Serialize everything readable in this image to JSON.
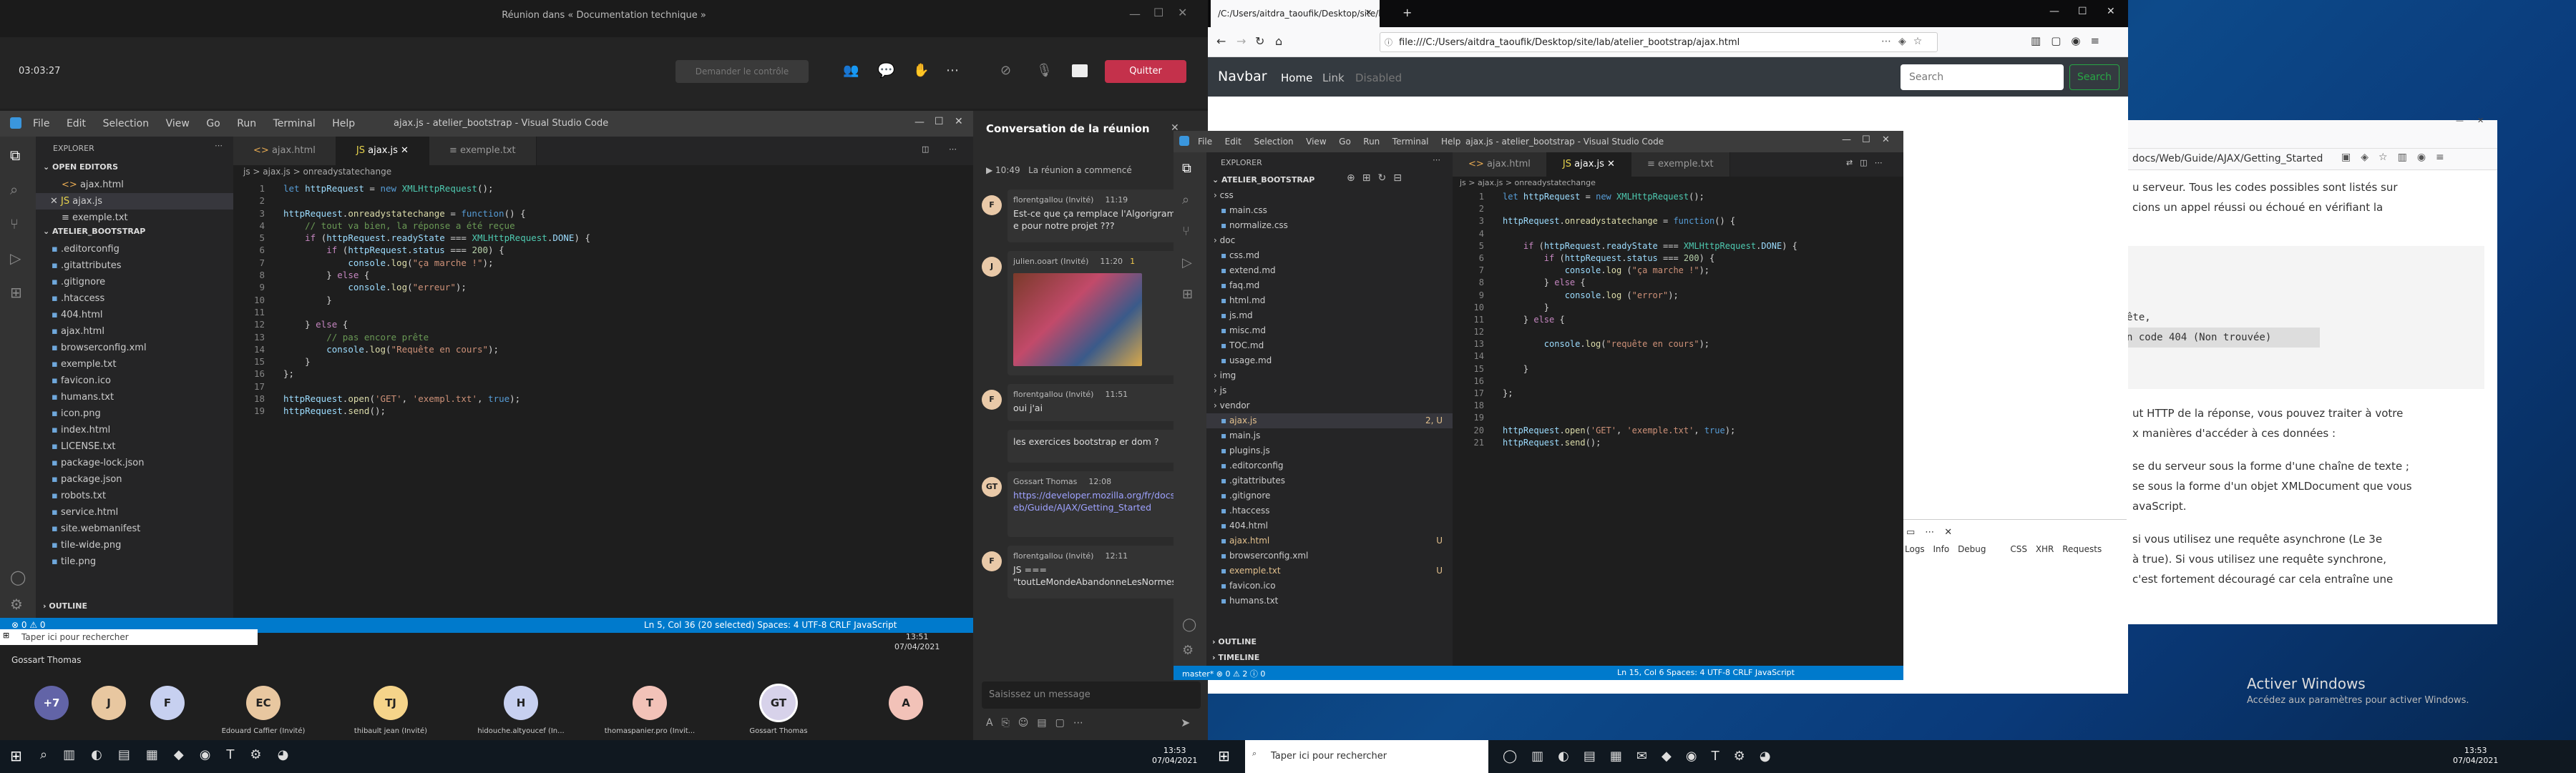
{
  "teams": {
    "window_title": "Réunion dans « Documentation technique »",
    "timer": "03:03:27",
    "request_control": "Demander le contrôle",
    "leave": "Quitter",
    "chat_title": "Conversation de la réunion",
    "chat_started_time": "10:49",
    "chat_started_text": "La réunion a commencé",
    "messages": [
      {
        "author": "florentgallou (Invité)",
        "time": "11:19",
        "text": "Est-ce que ça remplace l'Algorigramme pour notre projet ???",
        "avatar": "F"
      },
      {
        "author": "julien.ooart (Invité)",
        "time": "11:20",
        "text": "",
        "avatar": "J",
        "reaction": "1"
      },
      {
        "author": "florentgallou (Invité)",
        "time": "11:51",
        "text": "oui j'ai",
        "avatar": "F"
      },
      {
        "author": "",
        "time": "",
        "text": "les exercices bootstrap er dom ?",
        "avatar": ""
      },
      {
        "author": "Gossart Thomas",
        "time": "12:08",
        "text": "https://developer.mozilla.org/fr/docs/Web/Guide/AJAX/Getting_Started",
        "avatar": "GT"
      },
      {
        "author": "florentgallou (Invité)",
        "time": "12:11",
        "text": "JS ===\n\"toutLeMondeAbandonneLesNormes\"",
        "avatar": "F"
      }
    ],
    "compose_placeholder": "Saisissez un message",
    "participants": [
      {
        "label": "+7",
        "color": "#6264a7",
        "name": ""
      },
      {
        "label": "J",
        "color": "#e8c7a0",
        "name": ""
      },
      {
        "label": "F",
        "color": "#c7d0f0",
        "name": ""
      },
      {
        "label": "EC",
        "color": "#e8c7a0",
        "name": "Edouard Caffier (Invité)"
      },
      {
        "label": "TJ",
        "color": "#f5d48a",
        "name": "thibault jean (Invité)"
      },
      {
        "label": "H",
        "color": "#c7d0f0",
        "name": "hidouche.altyoucef (In..."
      },
      {
        "label": "T",
        "color": "#f2c2b8",
        "name": "thomaspanier.pro (Invit..."
      },
      {
        "label": "GT",
        "color": "#d7d2ea",
        "name": "Gossart Thomas"
      },
      {
        "label": "A",
        "color": "#f2c2b8",
        "name": ""
      }
    ],
    "speaker_label": "Gossart Thomas"
  },
  "vscode1": {
    "menus": [
      "File",
      "Edit",
      "Selection",
      "View",
      "Go",
      "Run",
      "Terminal",
      "Help"
    ],
    "title": "ajax.js - atelier_bootstrap - Visual Studio Code",
    "explorer_title": "EXPLORER",
    "open_editors": "OPEN EDITORS",
    "open_files": [
      "ajax.html",
      "ajax.js",
      "exemple.txt"
    ],
    "folder": "ATELIER_BOOTSTRAP",
    "files": [
      ".editorconfig",
      ".gitattributes",
      ".gitignore",
      ".htaccess",
      "404.html",
      "ajax.html",
      "browserconfig.xml",
      "exemple.txt",
      "favicon.ico",
      "humans.txt",
      "icon.png",
      "index.html",
      "LICENSE.txt",
      "package-lock.json",
      "package.json",
      "robots.txt",
      "service.html",
      "site.webmanifest",
      "tile-wide.png",
      "tile.png"
    ],
    "outline": "OUTLINE",
    "tabs": [
      "ajax.html",
      "ajax.js",
      "exemple.txt"
    ],
    "breadcrumb": "js > ajax.js > onreadystatechange",
    "code": [
      "let httpRequest = new XMLHttpRequest();",
      "",
      "httpRequest.onreadystatechange = function() {",
      "    // tout va bien, la réponse a été reçue",
      "    if (httpRequest.readyState === XMLHttpRequest.DONE) {",
      "        if (httpRequest.status === 200) {",
      "            console.log(\"ça marche !\");",
      "        } else {",
      "            console.log(\"erreur\");",
      "        }",
      "",
      "    } else {",
      "        // pas encore prête",
      "        console.log(\"Requête en cours\");",
      "    }",
      "};",
      "",
      "httpRequest.open('GET', 'exempl.txt', true);",
      "httpRequest.send();"
    ],
    "status_left": "⊗ 0 ⚠ 0",
    "status_right": "Ln 5, Col 36 (20 selected)   Spaces: 4   UTF-8   CRLF   JavaScript"
  },
  "taskbar_left": {
    "search_placeholder": "Taper ici pour rechercher",
    "time": "13:51",
    "date": "07/04/2021"
  },
  "firefox": {
    "tab_title": "/C:/Users/aitdra_taoufik/Desktop/site/lab/atelier_bootstrap/ajax.html",
    "url": "file:///C:/Users/aitdra_taoufik/Desktop/site/lab/atelier_bootstrap/ajax.html",
    "navbar_brand": "Navbar",
    "nav_links": [
      "Home",
      "Link",
      "Disabled"
    ],
    "search_placeholder": "Search",
    "search_button": "Search"
  },
  "vscode2": {
    "menus": [
      "File",
      "Edit",
      "Selection",
      "View",
      "Go",
      "Run",
      "Terminal",
      "Help"
    ],
    "title": "ajax.js - atelier_bootstrap - Visual Studio Code",
    "explorer_title": "EXPLORER",
    "folder": "ATELIER_BOOTSTRAP",
    "files": [
      {
        "name": "css",
        "kind": "folder"
      },
      {
        "name": "main.css",
        "kind": "file"
      },
      {
        "name": "normalize.css",
        "kind": "file"
      },
      {
        "name": "doc",
        "kind": "folder"
      },
      {
        "name": "css.md",
        "kind": "file"
      },
      {
        "name": "extend.md",
        "kind": "file"
      },
      {
        "name": "faq.md",
        "kind": "file"
      },
      {
        "name": "html.md",
        "kind": "file"
      },
      {
        "name": "js.md",
        "kind": "file"
      },
      {
        "name": "misc.md",
        "kind": "file"
      },
      {
        "name": "TOC.md",
        "kind": "file"
      },
      {
        "name": "usage.md",
        "kind": "file"
      },
      {
        "name": "img",
        "kind": "folder"
      },
      {
        "name": "js",
        "kind": "folder"
      },
      {
        "name": "vendor",
        "kind": "folder"
      },
      {
        "name": "ajax.js",
        "kind": "file",
        "badge": "2, U"
      },
      {
        "name": "main.js",
        "kind": "file"
      },
      {
        "name": "plugins.js",
        "kind": "file"
      },
      {
        "name": ".editorconfig",
        "kind": "file"
      },
      {
        "name": ".gitattributes",
        "kind": "file"
      },
      {
        "name": ".gitignore",
        "kind": "file"
      },
      {
        "name": ".htaccess",
        "kind": "file"
      },
      {
        "name": "404.html",
        "kind": "file"
      },
      {
        "name": "ajax.html",
        "kind": "file",
        "badge": "U"
      },
      {
        "name": "browserconfig.xml",
        "kind": "file"
      },
      {
        "name": "exemple.txt",
        "kind": "file",
        "badge": "U"
      },
      {
        "name": "favicon.ico",
        "kind": "file"
      },
      {
        "name": "humans.txt",
        "kind": "file"
      }
    ],
    "outline": "OUTLINE",
    "timeline": "TIMELINE",
    "tabs": [
      "ajax.html",
      "ajax.js",
      "exemple.txt"
    ],
    "breadcrumb": "js > ajax.js > onreadystatechange",
    "code": [
      "let httpRequest = new XMLHttpRequest();",
      "",
      "httpRequest.onreadystatechange = function() {",
      "",
      "    if (httpRequest.readyState === XMLHttpRequest.DONE) {",
      "        if (httpRequest.status === 200) {",
      "            console.log (\"ça marche !\");",
      "        } else {",
      "            console.log (\"error\");",
      "        }",
      "    } else {",
      "",
      "        console.log(\"requête en cours\");",
      "",
      "    }",
      "",
      "};",
      "",
      "",
      "httpRequest.open('GET', 'exemple.txt', true);",
      "httpRequest.send();"
    ],
    "status_left": "master*  ⊗ 0 ⚠ 2 ⓘ 0",
    "status_right": "Ln 15, Col 6   Spaces: 4   UTF-8   CRLF   JavaScript"
  },
  "mdn": {
    "url_fragment": "docs/Web/Guide/AJAX/Getting_Started",
    "para1": "u serveur. Tous les codes possibles sont listés sur",
    "para1b": "cions un appel réussi ou échoué en vérifiant la",
    "code1": "ête,",
    "code2": "n code 404 (Non trouvée)",
    "para2": "ut HTTP de la réponse, vous pouvez traiter à votre",
    "para2b": "x manières d'accéder à ces données :",
    "para3": "se du serveur sous la forme d'une chaîne de texte ;",
    "para3b": "se sous la forme d'un objet XMLDocument que vous",
    "para3c": "avaScript.",
    "para4": "si vous utilisez une requête asynchrone (Le 3e",
    "para4b": "à true). Si vous utilisez une requête synchrone,",
    "para4c": "c'est fortement découragé car cela entraîne une"
  },
  "devtools": {
    "tabs": [
      "Logs",
      "Info",
      "Debug",
      "CSS",
      "XHR",
      "Requests"
    ]
  },
  "activate": {
    "line1": "Activer Windows",
    "line2": "Accédez aux paramètres pour activer Windows."
  },
  "taskbar_right": {
    "search_placeholder": "Taper ici pour rechercher",
    "time": "13:53",
    "date": "07/04/2021"
  }
}
